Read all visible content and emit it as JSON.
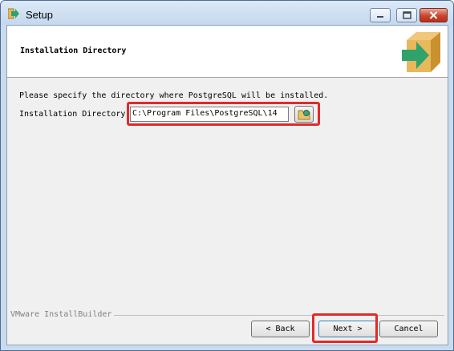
{
  "window": {
    "title": "Setup"
  },
  "header": {
    "title": "Installation Directory"
  },
  "body": {
    "instruction": "Please specify the directory where PostgreSQL will be installed.",
    "dir_label": "Installation Directory",
    "dir_value": "C:\\Program Files\\PostgreSQL\\14"
  },
  "footer": {
    "brand": "VMware InstallBuilder",
    "back_label": "< Back",
    "next_label": "Next >",
    "cancel_label": "Cancel"
  },
  "colors": {
    "highlight": "#e12a2a",
    "box": "#e8b85c",
    "arrow": "#2fa36b"
  },
  "icons": [
    "setup-app-icon",
    "package-box-icon",
    "browse-folder-icon",
    "minimize-icon",
    "maximize-icon",
    "close-icon"
  ]
}
